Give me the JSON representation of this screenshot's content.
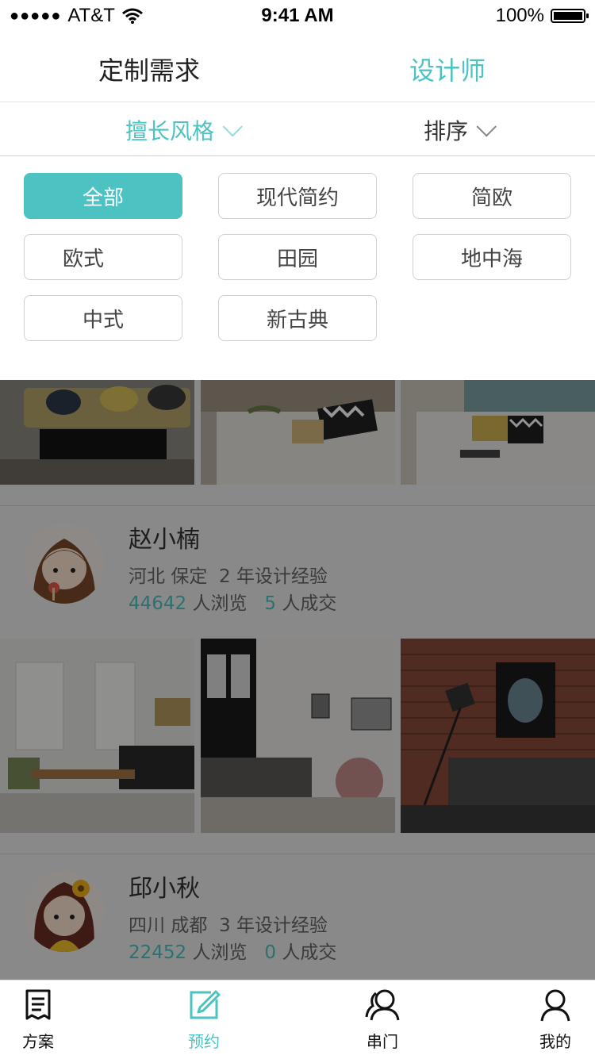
{
  "status_bar": {
    "carrier": "AT&T",
    "time": "9:41 AM",
    "battery": "100%"
  },
  "top_tabs": [
    {
      "label": "定制需求",
      "active": false
    },
    {
      "label": "设计师",
      "active": true
    }
  ],
  "filters": [
    {
      "label": "擅长风格",
      "active": true
    },
    {
      "label": "排序",
      "active": false
    }
  ],
  "style_tags": [
    "全部",
    "现代简约",
    "简欧",
    "欧式",
    "田园",
    "地中海",
    "中式",
    "新古典"
  ],
  "designers": [
    {
      "name": "赵小楠",
      "province": "河北",
      "city": "保定",
      "experience": "2 年设计经验",
      "views": "44642",
      "views_label": "人浏览",
      "deals": "5",
      "deals_label": "人成交"
    },
    {
      "name": "邱小秋",
      "province": "四川",
      "city": "成都",
      "experience": "3 年设计经验",
      "views": "22452",
      "views_label": "人浏览",
      "deals": "0",
      "deals_label": "人成交"
    }
  ],
  "bottom_nav": [
    {
      "label": "方案",
      "icon": "document-icon",
      "active": false
    },
    {
      "label": "预约",
      "icon": "edit-icon",
      "active": true
    },
    {
      "label": "串门",
      "icon": "users-icon",
      "active": false
    },
    {
      "label": "我的",
      "icon": "user-icon",
      "active": false
    }
  ],
  "colors": {
    "accent": "#4cc3c2",
    "text": "#222222",
    "overlay": "rgba(0,0,0,0.42)"
  }
}
